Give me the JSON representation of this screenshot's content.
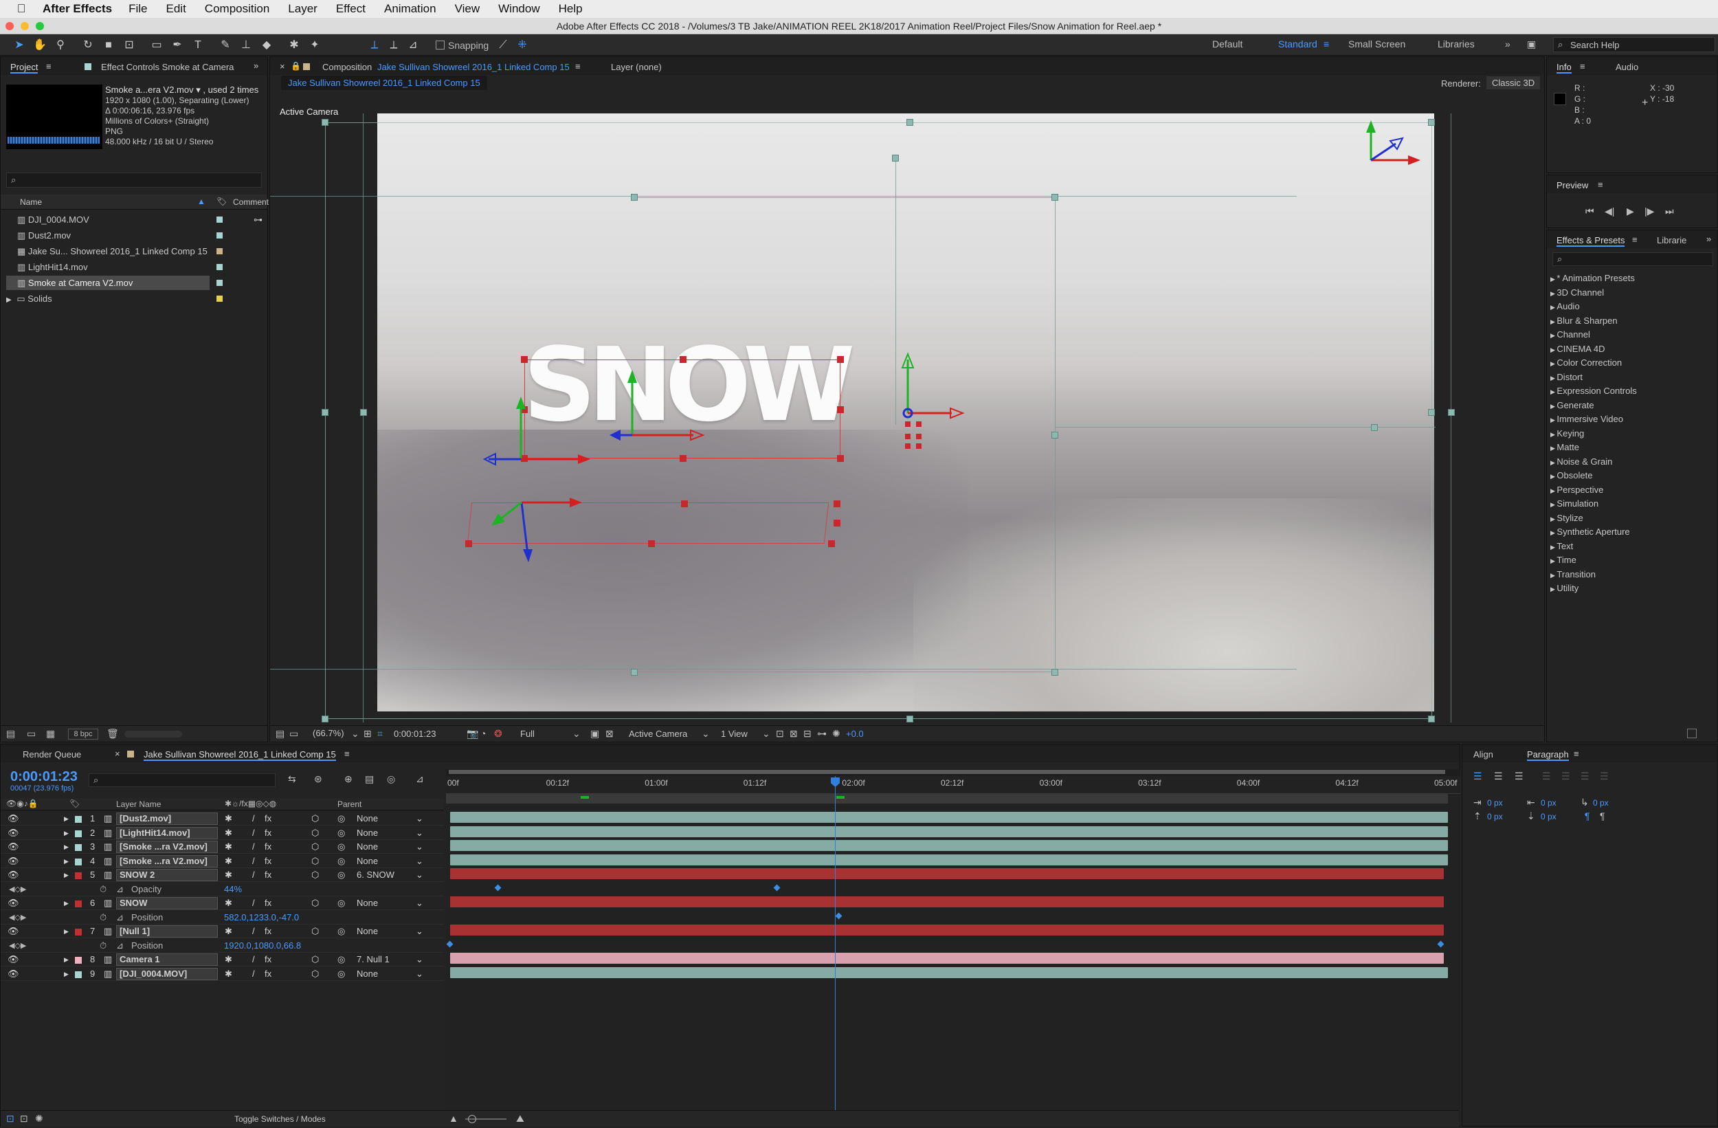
{
  "menubar": {
    "app": "After Effects",
    "items": [
      "File",
      "Edit",
      "Composition",
      "Layer",
      "Effect",
      "Animation",
      "View",
      "Window",
      "Help"
    ]
  },
  "window": {
    "title": "Adobe After Effects CC 2018 - /Volumes/3 TB Jake/ANIMATION REEL 2K18/2017 Animation Reel/Project Files/Snow Animation for Reel.aep *"
  },
  "toolbar": {
    "snapping": "Snapping"
  },
  "workspaces": {
    "default": "Default",
    "standard": "Standard",
    "small": "Small Screen",
    "libraries": "Libraries",
    "search_placeholder": "Search Help"
  },
  "project": {
    "tab": "Project",
    "tab2": "Effect Controls Smoke at Camera",
    "footage_name": "Smoke a...era V2.mov ▾ , used 2 times",
    "info": [
      "1920 x 1080 (1.00), Separating (Lower)",
      "Δ 0:00:06:16, 23.976 fps",
      "Millions of Colors+ (Straight)",
      "PNG",
      "48.000 kHz / 16 bit U / Stereo"
    ],
    "col_name": "Name",
    "col_comment": "Comment",
    "items": [
      {
        "name": "DJI_0004.MOV",
        "color": "#a8d5cf"
      },
      {
        "name": "Dust2.mov",
        "color": "#a8d5cf"
      },
      {
        "name": "Jake Su... Showreel 2016_1 Linked Comp 15",
        "color": "#c8b48a"
      },
      {
        "name": "LightHit14.mov",
        "color": "#a8d5cf"
      },
      {
        "name": "Smoke at Camera V2.mov",
        "color": "#a8d5cf"
      },
      {
        "name": "Solids",
        "color": "#e5d24a"
      }
    ],
    "bpc": "8 bpc"
  },
  "comp": {
    "tab_prefix": "Composition",
    "tab_name": "Jake Sullivan Showreel 2016_1 Linked Comp 15",
    "layer_tab": "Layer (none)",
    "subtab": "Jake Sullivan Showreel 2016_1 Linked Comp 15",
    "renderer_label": "Renderer:",
    "renderer": "Classic 3D",
    "view_label": "Active Camera",
    "snow_text": "SNOW",
    "zoom": "(66.7%)",
    "time": "0:00:01:23",
    "resolution": "Full",
    "camera": "Active Camera",
    "views": "1 View",
    "exposure": "+0.0"
  },
  "info": {
    "tab": "Info",
    "tab2": "Audio",
    "r": "R :",
    "g": "G :",
    "b": "B :",
    "a": "A :  0",
    "x": "X : -30",
    "y": "Y : -18"
  },
  "preview": {
    "title": "Preview"
  },
  "effects": {
    "tab": "Effects & Presets",
    "tab2": "Librarie",
    "items": [
      "* Animation Presets",
      "3D Channel",
      "Audio",
      "Blur & Sharpen",
      "Channel",
      "CINEMA 4D",
      "Color Correction",
      "Distort",
      "Expression Controls",
      "Generate",
      "Immersive Video",
      "Keying",
      "Matte",
      "Noise & Grain",
      "Obsolete",
      "Perspective",
      "Simulation",
      "Stylize",
      "Synthetic Aperture",
      "Text",
      "Time",
      "Transition",
      "Utility"
    ]
  },
  "timeline": {
    "tab1": "Render Queue",
    "tab2": "Jake Sullivan Showreel 2016_1 Linked Comp 15",
    "timecode": "0:00:01:23",
    "fps": "00047 (23.976 fps)",
    "col_layer": "Layer Name",
    "col_parent": "Parent",
    "ruler": [
      "00f",
      "00:12f",
      "01:00f",
      "01:12f",
      "02:00f",
      "02:12f",
      "03:00f",
      "03:12f",
      "04:00f",
      "04:12f",
      "05:00f"
    ],
    "layers": [
      {
        "num": "1",
        "name": "[Dust2.mov]",
        "parent": "None"
      },
      {
        "num": "2",
        "name": "[LightHit14.mov]",
        "parent": "None"
      },
      {
        "num": "3",
        "name": "[Smoke ...ra V2.mov]",
        "parent": "None"
      },
      {
        "num": "4",
        "name": "[Smoke ...ra V2.mov]",
        "parent": "None"
      },
      {
        "num": "5",
        "name": "SNOW 2",
        "parent": "6. SNOW"
      },
      {
        "prop": "Opacity",
        "value": "44%"
      },
      {
        "num": "6",
        "name": "SNOW",
        "parent": "None"
      },
      {
        "prop": "Position",
        "value": "582.0,1233.0,-47.0"
      },
      {
        "num": "7",
        "name": "[Null 1]",
        "parent": "None"
      },
      {
        "prop": "Position",
        "value": "1920.0,1080.0,66.8"
      },
      {
        "num": "8",
        "name": "Camera 1",
        "parent": "7. Null 1"
      },
      {
        "num": "9",
        "name": "[DJI_0004.MOV]",
        "parent": "None"
      }
    ],
    "toggle": "Toggle Switches / Modes"
  },
  "align": {
    "tab": "Align",
    "tab2": "Paragraph",
    "px": "0 px"
  }
}
